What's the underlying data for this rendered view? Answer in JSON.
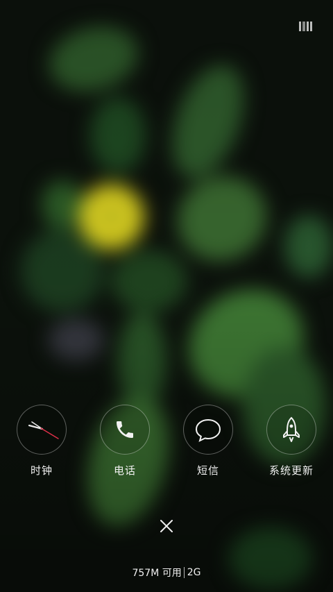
{
  "recents": {
    "apps": [
      {
        "label": "时钟",
        "icon": "clock-icon"
      },
      {
        "label": "电话",
        "icon": "phone-icon"
      },
      {
        "label": "短信",
        "icon": "message-icon"
      },
      {
        "label": "系统更新",
        "icon": "rocket-icon"
      }
    ],
    "close_icon": "close-icon",
    "top_icon": "view-toggle-icon"
  },
  "memory": {
    "available": "757M 可用",
    "freed": "2G"
  },
  "colors": {
    "text": "#f2f2f2",
    "clock_hand_red": "#e0304a",
    "ring": "rgba(255,255,255,0.35)"
  }
}
